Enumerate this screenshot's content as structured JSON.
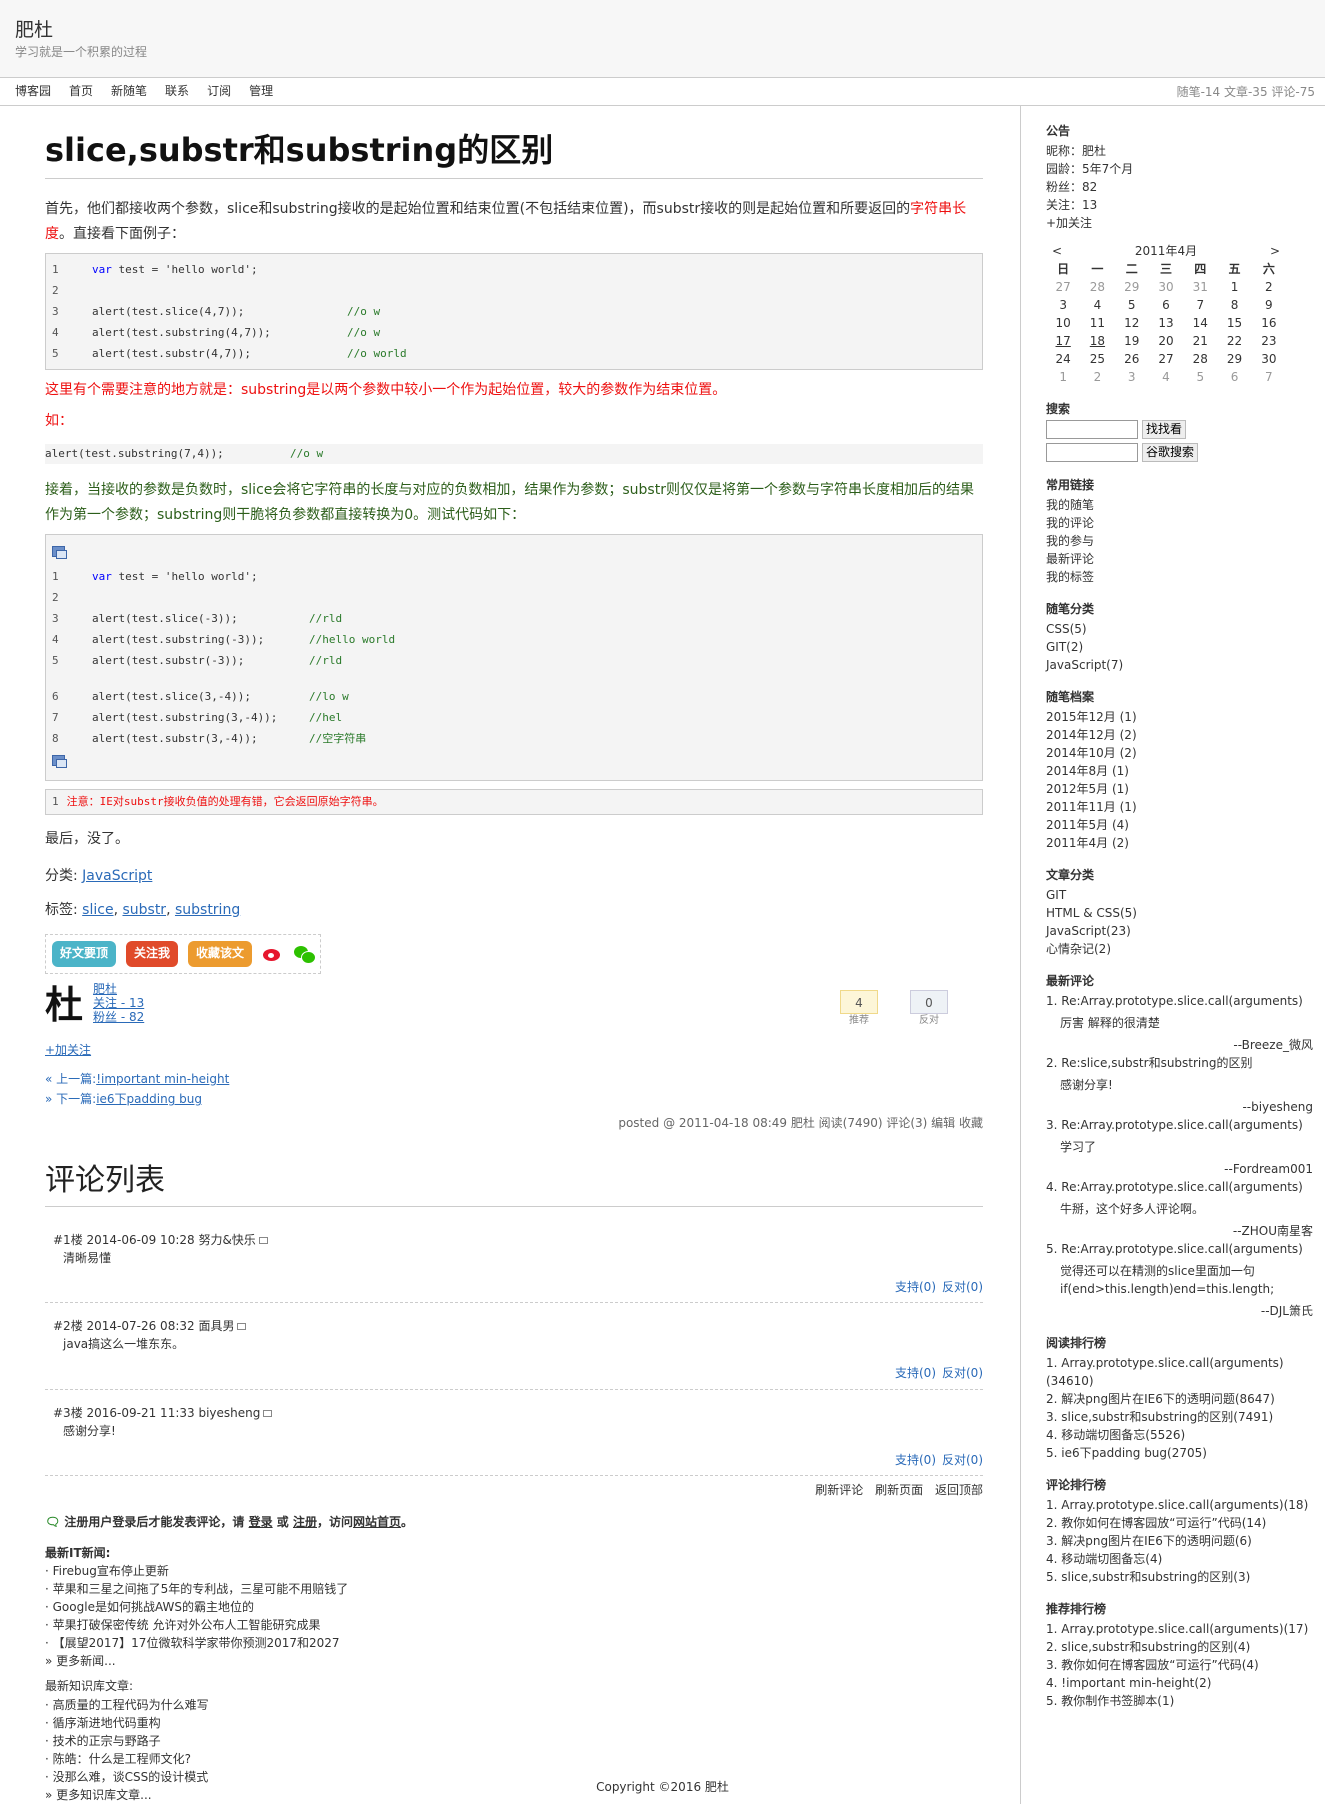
{
  "header": {
    "title": "肥杜",
    "subtitle": "学习就是一个积累的过程"
  },
  "nav": {
    "items": [
      "博客园",
      "首页",
      "新随笔",
      "联系",
      "订阅",
      "管理"
    ],
    "stats": "随笔-14  文章-35  评论-75"
  },
  "post": {
    "title": "slice,substr和substring的区别",
    "intro_a": "首先，他们都接收两个参数，slice和substring接收的是起始位置和结束位置(不包括结束位置)，而substr接收的则是起始位置和所要返回的",
    "intro_red": "字符串长度",
    "intro_b": "。直接看下面例子：",
    "code1": [
      {
        "n": "1",
        "stmt": "var test = 'hello world';",
        "cm": ""
      },
      {
        "n": "2",
        "stmt": "",
        "cm": ""
      },
      {
        "n": "3",
        "stmt": "alert(test.slice(4,7));",
        "cm": "//o w"
      },
      {
        "n": "4",
        "stmt": "alert(test.substring(4,7));",
        "cm": "//o w"
      },
      {
        "n": "5",
        "stmt": "alert(test.substr(4,7));",
        "cm": "//o world"
      }
    ],
    "warn_text": "这里有个需要注意的地方就是：substring是以两个参数中较小一个作为起始位置，较大的参数作为结束位置。",
    "example_label": "如：",
    "inline_code": {
      "stmt": "alert(test.substring(7,4));",
      "cm": "//o w"
    },
    "para2": "接着，当接收的参数是负数时，slice会将它字符串的长度与对应的负数相加，结果作为参数；substr则仅仅是将第一个参数与字符串长度相加后的结果作为第一个参数；substring则干脆将负参数都直接转换为0。测试代码如下：",
    "code2": [
      {
        "n": "1",
        "stmt": "var test = 'hello world';",
        "cm": ""
      },
      {
        "n": "2",
        "stmt": "",
        "cm": ""
      },
      {
        "n": "3",
        "stmt": "alert(test.slice(-3));",
        "cm": "//rld"
      },
      {
        "n": "4",
        "stmt": "alert(test.substring(-3));",
        "cm": "//hello world"
      },
      {
        "n": "5",
        "stmt": "alert(test.substr(-3));",
        "cm": "//rld"
      },
      {
        "n": "",
        "stmt": "",
        "cm": ""
      },
      {
        "n": "6",
        "stmt": "alert(test.slice(3,-4));",
        "cm": "//lo w"
      },
      {
        "n": "7",
        "stmt": "alert(test.substring(3,-4));",
        "cm": "//hel"
      },
      {
        "n": "8",
        "stmt": "alert(test.substr(3,-4));",
        "cm": "//空字符串"
      }
    ],
    "note_num": "1",
    "note_text": "注意：IE对substr接收负值的处理有错，它会返回原始字符串。",
    "ending": "最后，没了。",
    "category_label": "分类: ",
    "category": "JavaScript",
    "tags_label": "标签: ",
    "tags": [
      "slice",
      "substr",
      "substring"
    ],
    "share": {
      "good": "好文要顶",
      "follow": "关注我",
      "fav": "收藏该文"
    },
    "author": {
      "logo": "杜",
      "name": "肥杜",
      "follow": "关注 - 13",
      "fans": "粉丝 - 82",
      "add_follow": "+加关注"
    },
    "votes": {
      "up": "4",
      "up_label": "推荐",
      "down": "0",
      "down_label": "反对"
    },
    "prev_label": "« 上一篇:",
    "prev": "!important min-height",
    "next_label": "» 下一篇:",
    "next": "ie6下padding bug",
    "desc": "posted @ 2011-04-18 08:49 肥杜 阅读(7490) 评论(3) 编辑 收藏"
  },
  "comments": {
    "title": "评论列表",
    "items": [
      {
        "head": "#1楼 2014-06-09 10:28 努力&快乐",
        "body": "清晰易懂",
        "support": "支持(0)",
        "oppose": "反对(0)"
      },
      {
        "head": "#2楼 2014-07-26 08:32 面具男",
        "body": "java搞这么一堆东东。",
        "support": "支持(0)",
        "oppose": "反对(0)"
      },
      {
        "head": "#3楼 2016-09-21 11:33 biyesheng",
        "body": "感谢分享!",
        "support": "支持(0)",
        "oppose": "反对(0)"
      }
    ],
    "tools": [
      "刷新评论",
      "刷新页面",
      "返回顶部"
    ],
    "login_tip_a": "注册用户登录后才能发表评论，请 ",
    "login": "登录",
    "login_tip_b": " 或 ",
    "register": "注册",
    "login_tip_c": "，",
    "home": "访问",
    "home2": "网站首页",
    "login_tip_d": "。"
  },
  "news": {
    "title": "最新IT新闻:",
    "items": [
      "· Firebug宣布停止更新",
      "· 苹果和三星之间拖了5年的专利战，三星可能不用赔钱了",
      "· Google是如何挑战AWS的霸主地位的",
      "· 苹果打破保密传统 允许对外公布人工智能研究成果",
      "· 【展望2017】17位微软科学家带你预测2017和2027"
    ],
    "more": "» 更多新闻...",
    "kb_title": "最新知识库文章:",
    "kb_items": [
      "· 高质量的工程代码为什么难写",
      "· 循序渐进地代码重构",
      "· 技术的正宗与野路子",
      "· 陈皓：什么是工程师文化?",
      "· 没那么难，谈CSS的设计模式"
    ],
    "kb_more": "» 更多知识库文章..."
  },
  "footer": "Copyright ©2016 肥杜",
  "sidebar": {
    "notice_title": "公告",
    "notice": [
      "昵称：肥杜",
      "园龄：5年7个月",
      "粉丝：82",
      "关注：13",
      "+加关注"
    ],
    "cal_prev": "<",
    "cal_title": "2011年4月",
    "cal_next": ">",
    "cal_week": [
      "日",
      "一",
      "二",
      "三",
      "四",
      "五",
      "六"
    ],
    "cal_rows": [
      [
        "27",
        "28",
        "29",
        "30",
        "31",
        "1",
        "2"
      ],
      [
        "3",
        "4",
        "5",
        "6",
        "7",
        "8",
        "9"
      ],
      [
        "10",
        "11",
        "12",
        "13",
        "14",
        "15",
        "16"
      ],
      [
        "17",
        "18",
        "19",
        "20",
        "21",
        "22",
        "23"
      ],
      [
        "24",
        "25",
        "26",
        "27",
        "28",
        "29",
        "30"
      ],
      [
        "1",
        "2",
        "3",
        "4",
        "5",
        "6",
        "7"
      ]
    ],
    "search_title": "搜索",
    "search_btn": "找找看",
    "google_btn": "谷歌搜索",
    "links_title": "常用链接",
    "links": [
      "我的随笔",
      "我的评论",
      "我的参与",
      "最新评论",
      "我的标签"
    ],
    "cat_title": "随笔分类",
    "cats": [
      "CSS(5)",
      "GIT(2)",
      "JavaScript(7)"
    ],
    "archive_title": "随笔档案",
    "archives": [
      "2015年12月 (1)",
      "2014年12月 (2)",
      "2014年10月 (2)",
      "2014年8月 (1)",
      "2012年5月 (1)",
      "2011年11月 (1)",
      "2011年5月 (4)",
      "2011年4月 (2)"
    ],
    "article_cat_title": "文章分类",
    "article_cats": [
      "GIT",
      "HTML & CSS(5)",
      "JavaScript(23)",
      "心情杂记(2)"
    ],
    "recent_title": "最新评论",
    "recent": [
      {
        "t": "1. Re:Array.prototype.slice.call(arguments)",
        "b": "厉害  解释的很清楚",
        "a": "--Breeze_微风"
      },
      {
        "t": "2. Re:slice,substr和substring的区别",
        "b": "感谢分享!",
        "a": "--biyesheng"
      },
      {
        "t": "3. Re:Array.prototype.slice.call(arguments)",
        "b": "学习了",
        "a": "--Fordream001"
      },
      {
        "t": "4. Re:Array.prototype.slice.call(arguments)",
        "b": "牛掰，这个好多人评论啊。",
        "a": "--ZHOU南星客"
      },
      {
        "t": "5. Re:Array.prototype.slice.call(arguments)",
        "b": "觉得还可以在精测的slice里面加一句if(end>this.length)end=this.length;",
        "a": "--DJL箫氏"
      }
    ],
    "read_title": "阅读排行榜",
    "reads": [
      "1. Array.prototype.slice.call(arguments)(34610)",
      "2. 解决png图片在IE6下的透明问题(8647)",
      "3. slice,substr和substring的区别(7491)",
      "4. 移动端切图备忘(5526)",
      "5. ie6下padding bug(2705)"
    ],
    "comment_rank_title": "评论排行榜",
    "comment_ranks": [
      "1. Array.prototype.slice.call(arguments)(18)",
      "2. 教你如何在博客园放“可运行”代码(14)",
      "3. 解决png图片在IE6下的透明问题(6)",
      "4. 移动端切图备忘(4)",
      "5. slice,substr和substring的区别(3)"
    ],
    "rec_title": "推荐排行榜",
    "recs": [
      "1. Array.prototype.slice.call(arguments)(17)",
      "2. slice,substr和substring的区别(4)",
      "3. 教你如何在博客园放“可运行”代码(4)",
      "4. !important min-height(2)",
      "5. 教你制作书签脚本(1)"
    ]
  }
}
